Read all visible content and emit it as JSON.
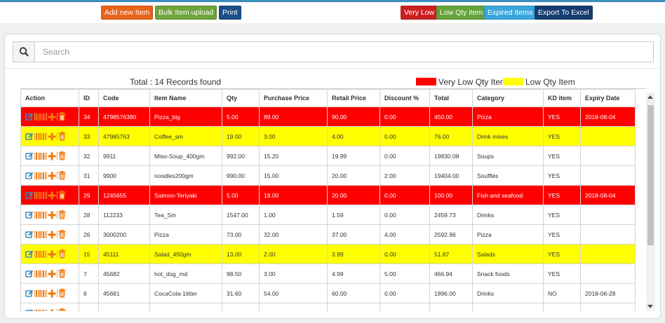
{
  "toolbar": {
    "add_label": "Add new Item",
    "bulk_label": "Bulk Item upload",
    "print_label": "Print",
    "separator": "|",
    "very_low_label": "Very Low",
    "low_qty_label": "Low Qty item",
    "expired_label": "Expired Items",
    "export_label": "Export To Excel"
  },
  "search": {
    "placeholder": "Search"
  },
  "summary": {
    "total": "Total : 14 Records found"
  },
  "legend": {
    "very_low": "Very Low Qty Item",
    "low": "Low Qty Item",
    "very_low_color": "#ff0000",
    "low_color": "#ffff00"
  },
  "table": {
    "headers": [
      "Action",
      "ID",
      "Code",
      "Item Name",
      "Qty",
      "Purchase Price",
      "Retail Price",
      "Discount %",
      "Total",
      "Category",
      "KD item",
      "Expiry Date"
    ],
    "rows": [
      {
        "status": "very-low",
        "cells": [
          "34",
          "4798576390",
          "Pizza_big",
          "5.00",
          "89.00",
          "90.00",
          "0.00",
          "450.00",
          "Pizza",
          "YES",
          "2018-08-04"
        ]
      },
      {
        "status": "low",
        "cells": [
          "33",
          "47985763",
          "Coffee_sm",
          "19.00",
          "3.00",
          "4.00",
          "0.00",
          "76.00",
          "Drink mixes",
          "YES",
          ""
        ]
      },
      {
        "status": "normal",
        "cells": [
          "32",
          "9911",
          "Miso-Soup_400gm",
          "992.00",
          "15.20",
          "19.99",
          "0.00",
          "19830.08",
          "Soups",
          "YES",
          ""
        ]
      },
      {
        "status": "normal",
        "cells": [
          "31",
          "9900",
          "noodles200gm",
          "990.00",
          "15.00",
          "20.00",
          "2.00",
          "19404.00",
          "Soufflés",
          "YES",
          ""
        ]
      },
      {
        "status": "very-low",
        "cells": [
          "29",
          "1245655",
          "Salmon-Teriyaki",
          "5.00",
          "18.00",
          "20.00",
          "0.00",
          "100.00",
          "Fish and seafood",
          "YES",
          "2018-08-04"
        ]
      },
      {
        "status": "normal",
        "cells": [
          "28",
          "112233",
          "Tea_Sm",
          "1547.00",
          "1.00",
          "1.59",
          "0.00",
          "2459.73",
          "Drinks",
          "YES",
          ""
        ]
      },
      {
        "status": "normal",
        "cells": [
          "26",
          "3000200",
          "Pizza",
          "73.00",
          "32.00",
          "37.00",
          "4.00",
          "2592.96",
          "Pizza",
          "YES",
          ""
        ]
      },
      {
        "status": "low",
        "cells": [
          "15",
          "45111",
          "Salad_450gm",
          "13.00",
          "2.00",
          "3.99",
          "0.00",
          "51.87",
          "Salads",
          "YES",
          ""
        ]
      },
      {
        "status": "normal",
        "cells": [
          "7",
          "45682",
          "hot_dog_md",
          "98.50",
          "3.00",
          "4.99",
          "5.00",
          "466.94",
          "Snack foods",
          "YES",
          ""
        ]
      },
      {
        "status": "normal",
        "cells": [
          "6",
          "45681",
          "CocaCola-1litter",
          "31.60",
          "54.00",
          "60.00",
          "0.00",
          "1896.00",
          "Drinks",
          "NO",
          "2018-06-28"
        ]
      },
      {
        "status": "normal",
        "cells": [
          "",
          "",
          "",
          "",
          "",
          "",
          "",
          "",
          "",
          "",
          ""
        ]
      }
    ]
  },
  "colors": {
    "add": "#e8641b",
    "bulk": "#6fa33c",
    "print": "#1a4f87",
    "very_low_btn": "#cc1f1f",
    "low_btn": "#64a33a",
    "expired_btn": "#3aa6dc",
    "export_btn": "#163c70",
    "edit_icon": "#3c8dbc",
    "action_icon": "#f07a10"
  },
  "icons": {
    "search": "search-icon",
    "edit": "edit-icon",
    "barcode": "barcode-icon",
    "add": "plus-icon",
    "delete": "trash-icon"
  }
}
